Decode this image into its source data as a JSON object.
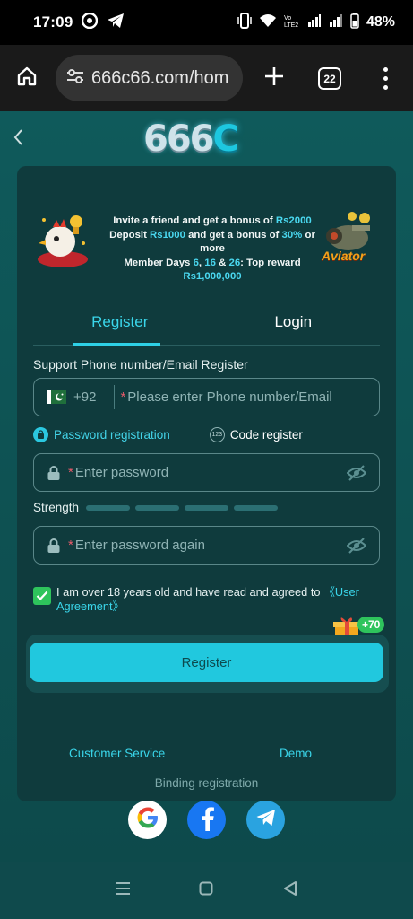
{
  "status_bar": {
    "time": "17:09",
    "battery": "48%",
    "network_label": "Vo LTE2",
    "icons": [
      "chrome-icon",
      "telegram-icon",
      "vibrate-icon",
      "wifi-icon",
      "signal-icon",
      "signal-icon",
      "battery-icon"
    ]
  },
  "browser": {
    "url": "666c66.com/hom",
    "tab_count": "22"
  },
  "header": {
    "logo_text": "666",
    "logo_c": "C"
  },
  "promo": {
    "line1_a": "Invite a friend and get a bonus of ",
    "line1_b": "Rs2000",
    "line2_a": "Deposit ",
    "line2_b": "Rs1000",
    "line2_c": " and get a bonus of ",
    "line2_d": "30%",
    "line2_e": " or more",
    "line3_a": "Member Days ",
    "line3_b": "6",
    "line3_c": ", ",
    "line3_d": "16",
    "line3_e": " & ",
    "line3_f": "26",
    "line3_g": ": Top reward ",
    "line3_h": "Rs1,000,000",
    "aviator_label": "Aviator"
  },
  "tabs": {
    "register": "Register",
    "login": "Login"
  },
  "form": {
    "section_label": "Support Phone number/Email Register",
    "country_code": "+92",
    "phone_placeholder": "Please enter Phone number/Email",
    "mode_password": "Password registration",
    "mode_code": "Code register",
    "mode_code_icon_text": "123",
    "password_placeholder": "Enter password",
    "strength_label": "Strength",
    "password_again_placeholder": "Enter password again",
    "required_mark": "*",
    "agree_text": "I am over 18 years old and have read and agreed to ",
    "agree_link": "《User Agreement》",
    "gift_bonus": "+70",
    "register_button": "Register"
  },
  "links": {
    "customer_service": "Customer Service",
    "demo": "Demo",
    "binding": "Binding registration"
  },
  "socials": [
    "google-icon",
    "facebook-icon",
    "telegram-icon"
  ],
  "colors": {
    "accent": "#21c8de",
    "card": "#0f3b3d",
    "background": "#0f4a4c",
    "check": "#2ec45c"
  }
}
